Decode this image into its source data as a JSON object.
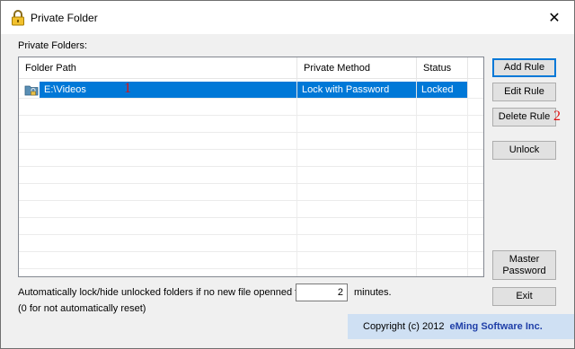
{
  "window": {
    "title": "Private Folder",
    "close_glyph": "✕"
  },
  "folders_label": "Private Folders:",
  "list": {
    "columns": [
      "Folder Path",
      "Private Method",
      "Status"
    ],
    "rows": [
      {
        "path": "E:\\Videos",
        "method": "Lock with Password",
        "status": "Locked",
        "selected": true,
        "icon": "locked-folder-icon"
      }
    ]
  },
  "buttons": {
    "add_rule": "Add Rule",
    "edit_rule": "Edit Rule",
    "delete_rule": "Delete Rule",
    "unlock": "Unlock",
    "master_password": "Master Password",
    "exit": "Exit"
  },
  "annotations": {
    "one": "1",
    "two": "2"
  },
  "auto_lock": {
    "text": "Automatically lock/hide unlocked folders if no new file openned for",
    "minutes_value": "2",
    "minutes_label": "minutes.",
    "reset_note": "(0 for not automatically reset)"
  },
  "footer": {
    "copyright": "Copyright (c) 2012",
    "company": "eMing Software Inc."
  },
  "colors": {
    "selection": "#0078d7",
    "annotation": "#e01010",
    "footer_bg": "#cfe0f3",
    "company_text": "#1f3fa8"
  }
}
